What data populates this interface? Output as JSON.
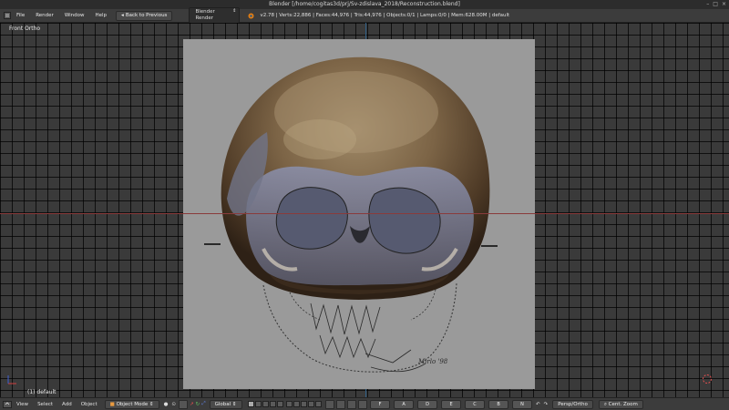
{
  "window": {
    "title": "Blender [/home/cogitas3d/prj/Sv-zdislava_2018/Reconstruction.blend]",
    "controls": [
      "–",
      "□",
      "×"
    ]
  },
  "info_header": {
    "menus": [
      "File",
      "Render",
      "Window",
      "Help"
    ],
    "back_button": "Back to Previous",
    "render_engine": "Blender Render",
    "stats": "v2.78 | Verts:22,886 | Faces:44,976 | Tris:44,976 | Objects:0/1 | Lamps:0/0 | Mem:628.00M | default"
  },
  "viewport": {
    "view_label": "Front Ortho",
    "object_label": "(1) default",
    "background": "#3a3a3a",
    "grid_color": "#000000",
    "x_axis_color": "#8a3b3b",
    "z_axis_color": "#2f5f86"
  },
  "view3d_header": {
    "menus": [
      "View",
      "Select",
      "Add",
      "Object"
    ],
    "mode": "Object Mode",
    "orientation": "Global",
    "keys": [
      "F",
      "A",
      "D",
      "E",
      "C",
      "B",
      "N"
    ],
    "persp_ortho": "Persp/Ortho",
    "cent_zoom": "Cent. Zoom",
    "icons": [
      "editor-type-icon",
      "viewport-shading-icon",
      "pivot-icon",
      "manipulator-icon",
      "translate-icon",
      "rotate-icon",
      "scale-icon",
      "snap-icon",
      "proportional-icon",
      "render-icon",
      "undo-icon",
      "redo-icon"
    ]
  }
}
